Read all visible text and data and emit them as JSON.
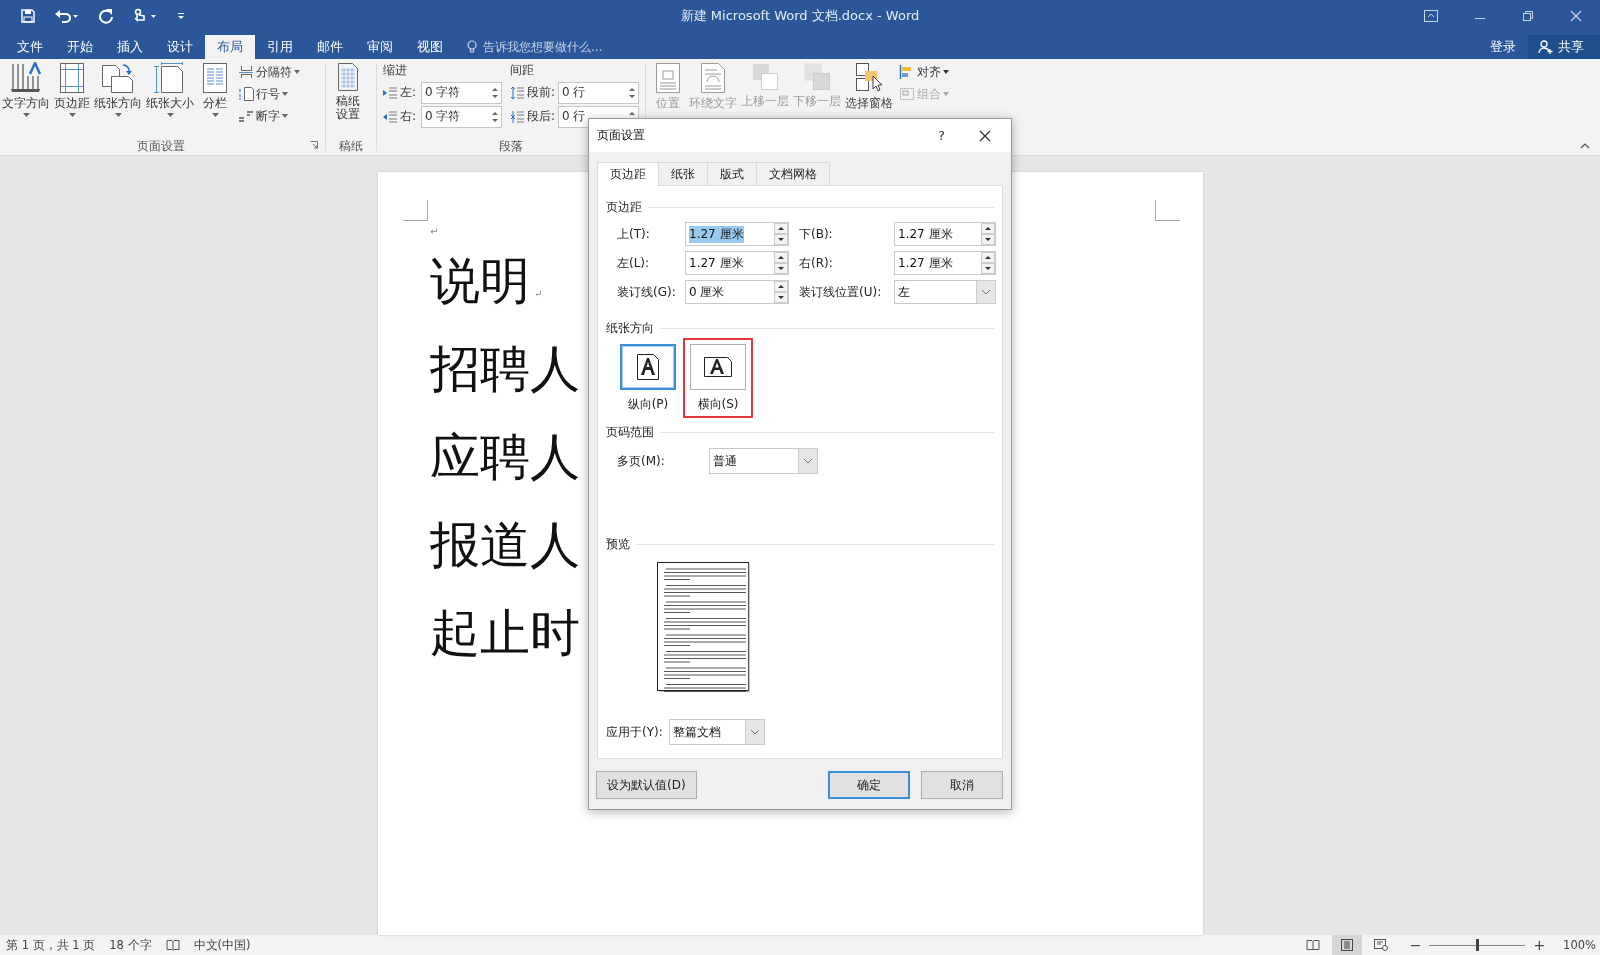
{
  "window": {
    "title": "新建 Microsoft Word 文档.docx - Word",
    "sign_in": "登录",
    "share": "共享"
  },
  "menu_tabs": [
    {
      "label": "文件",
      "selected": false
    },
    {
      "label": "开始",
      "selected": false
    },
    {
      "label": "插入",
      "selected": false
    },
    {
      "label": "设计",
      "selected": false
    },
    {
      "label": "布局",
      "selected": true
    },
    {
      "label": "引用",
      "selected": false
    },
    {
      "label": "邮件",
      "selected": false
    },
    {
      "label": "审阅",
      "selected": false
    },
    {
      "label": "视图",
      "selected": false
    }
  ],
  "tell_me": {
    "placeholder": "告诉我您想要做什么..."
  },
  "page_setup_group": {
    "label": "页面设置",
    "large_buttons": [
      "文字方向",
      "页边距",
      "纸张方向",
      "纸张大小",
      "分栏"
    ],
    "small_buttons": [
      "分隔符",
      "行号",
      "断字"
    ]
  },
  "manuscript_group": {
    "label": "稿纸",
    "button_lines": [
      "稿纸",
      "设置"
    ]
  },
  "paragraph_group": {
    "label": "段落",
    "indent": {
      "label": "缩进",
      "fields": [
        {
          "label": "左:",
          "value": "0 字符"
        },
        {
          "label": "右:",
          "value": "0 字符"
        }
      ]
    },
    "spacing": {
      "label": "间距",
      "fields": [
        {
          "label": "段前:",
          "value": "0 行"
        },
        {
          "label": "段后:",
          "value": "0 行"
        }
      ]
    }
  },
  "arrange_group": {
    "large_buttons": [
      {
        "label": "位置",
        "disabled": true
      },
      {
        "label": "环绕文字",
        "disabled": true
      },
      {
        "label": "上移一层",
        "disabled": true
      },
      {
        "label": "下移一层",
        "disabled": true
      },
      {
        "label": "选择窗格",
        "disabled": false
      }
    ],
    "small_buttons": [
      {
        "label": "对齐",
        "disabled": false
      },
      {
        "label": "组合",
        "disabled": true
      }
    ]
  },
  "document": {
    "top_mark": "↵",
    "lines": [
      {
        "text": "说明",
        "mark": "↵"
      },
      {
        "text": "招聘人"
      },
      {
        "text": "应聘人"
      },
      {
        "text": "报道人"
      },
      {
        "text": "起止时"
      }
    ]
  },
  "dialog": {
    "title": "页面设置",
    "help": "?",
    "tabs": [
      {
        "label": "页边距",
        "selected": true
      },
      {
        "label": "纸张",
        "selected": false
      },
      {
        "label": "版式",
        "selected": false
      },
      {
        "label": "文档网格",
        "selected": false
      }
    ],
    "margins": {
      "label": "页边距",
      "fields": [
        {
          "label": "上(T):",
          "value": "1.27 厘米",
          "kind": "spin",
          "text_selected": true
        },
        {
          "label": "下(B):",
          "value": "1.27 厘米",
          "kind": "spin",
          "text_selected": false
        },
        {
          "label": "左(L):",
          "value": "1.27 厘米",
          "kind": "spin",
          "text_selected": false
        },
        {
          "label": "右(R):",
          "value": "1.27 厘米",
          "kind": "spin",
          "text_selected": false
        },
        {
          "label": "装订线(G):",
          "value": "0 厘米",
          "kind": "spin",
          "text_selected": false
        },
        {
          "label": "装订线位置(U):",
          "value": "左",
          "kind": "dropdown",
          "text_selected": false
        }
      ]
    },
    "orientation": {
      "label": "纸张方向",
      "options": [
        {
          "label": "纵向(P)",
          "selected": true,
          "highlighted": false
        },
        {
          "label": "横向(S)",
          "selected": false,
          "highlighted": true
        }
      ]
    },
    "pages": {
      "label": "页码范围",
      "multiple_pages": {
        "label": "多页(M):",
        "value": "普通"
      }
    },
    "preview": {
      "label": "预览"
    },
    "apply_to": {
      "label": "应用于(Y):",
      "value": "整篇文档"
    },
    "buttons": [
      {
        "label": "设为默认值(D)",
        "default": false
      },
      {
        "label": "确定",
        "default": true
      },
      {
        "label": "取消",
        "default": false
      }
    ]
  },
  "status_bar": {
    "page": "第 1 页，共 1 页",
    "words": "18 个字",
    "language": "中文(中国)",
    "views": [
      {
        "selected": false
      },
      {
        "selected": true
      },
      {
        "selected": false
      }
    ],
    "zoom_out": "−",
    "zoom_in": "+",
    "zoom": {
      "level": 0.5
    },
    "zoom_text": "100%"
  }
}
